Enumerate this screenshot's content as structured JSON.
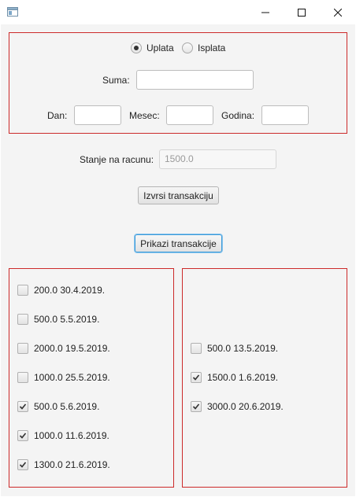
{
  "window": {
    "controls": {
      "minimize_icon": "minimize-icon",
      "maximize_icon": "maximize-icon",
      "close_icon": "close-icon"
    }
  },
  "form": {
    "radio_uplata": {
      "label": "Uplata",
      "selected": true
    },
    "radio_isplata": {
      "label": "Isplata",
      "selected": false
    },
    "suma_label": "Suma:",
    "suma_value": "",
    "dan_label": "Dan:",
    "dan_value": "",
    "mesec_label": "Mesec:",
    "mesec_value": "",
    "godina_label": "Godina:",
    "godina_value": ""
  },
  "balance": {
    "label": "Stanje na racunu:",
    "value": "1500.0"
  },
  "buttons": {
    "izvrsi": "Izvrsi transakciju",
    "prikazi": "Prikazi transakcije"
  },
  "left_list": [
    {
      "text": "200.0 30.4.2019.",
      "checked": false
    },
    {
      "text": "500.0 5.5.2019.",
      "checked": false
    },
    {
      "text": "2000.0 19.5.2019.",
      "checked": false
    },
    {
      "text": "1000.0 25.5.2019.",
      "checked": false
    },
    {
      "text": "500.0 5.6.2019.",
      "checked": true
    },
    {
      "text": "1000.0 11.6.2019.",
      "checked": true
    },
    {
      "text": "1300.0 21.6.2019.",
      "checked": true
    }
  ],
  "right_list": [
    {
      "text": "500.0 13.5.2019.",
      "checked": false
    },
    {
      "text": "1500.0 1.6.2019.",
      "checked": true
    },
    {
      "text": "3000.0 20.6.2019.",
      "checked": true
    }
  ]
}
